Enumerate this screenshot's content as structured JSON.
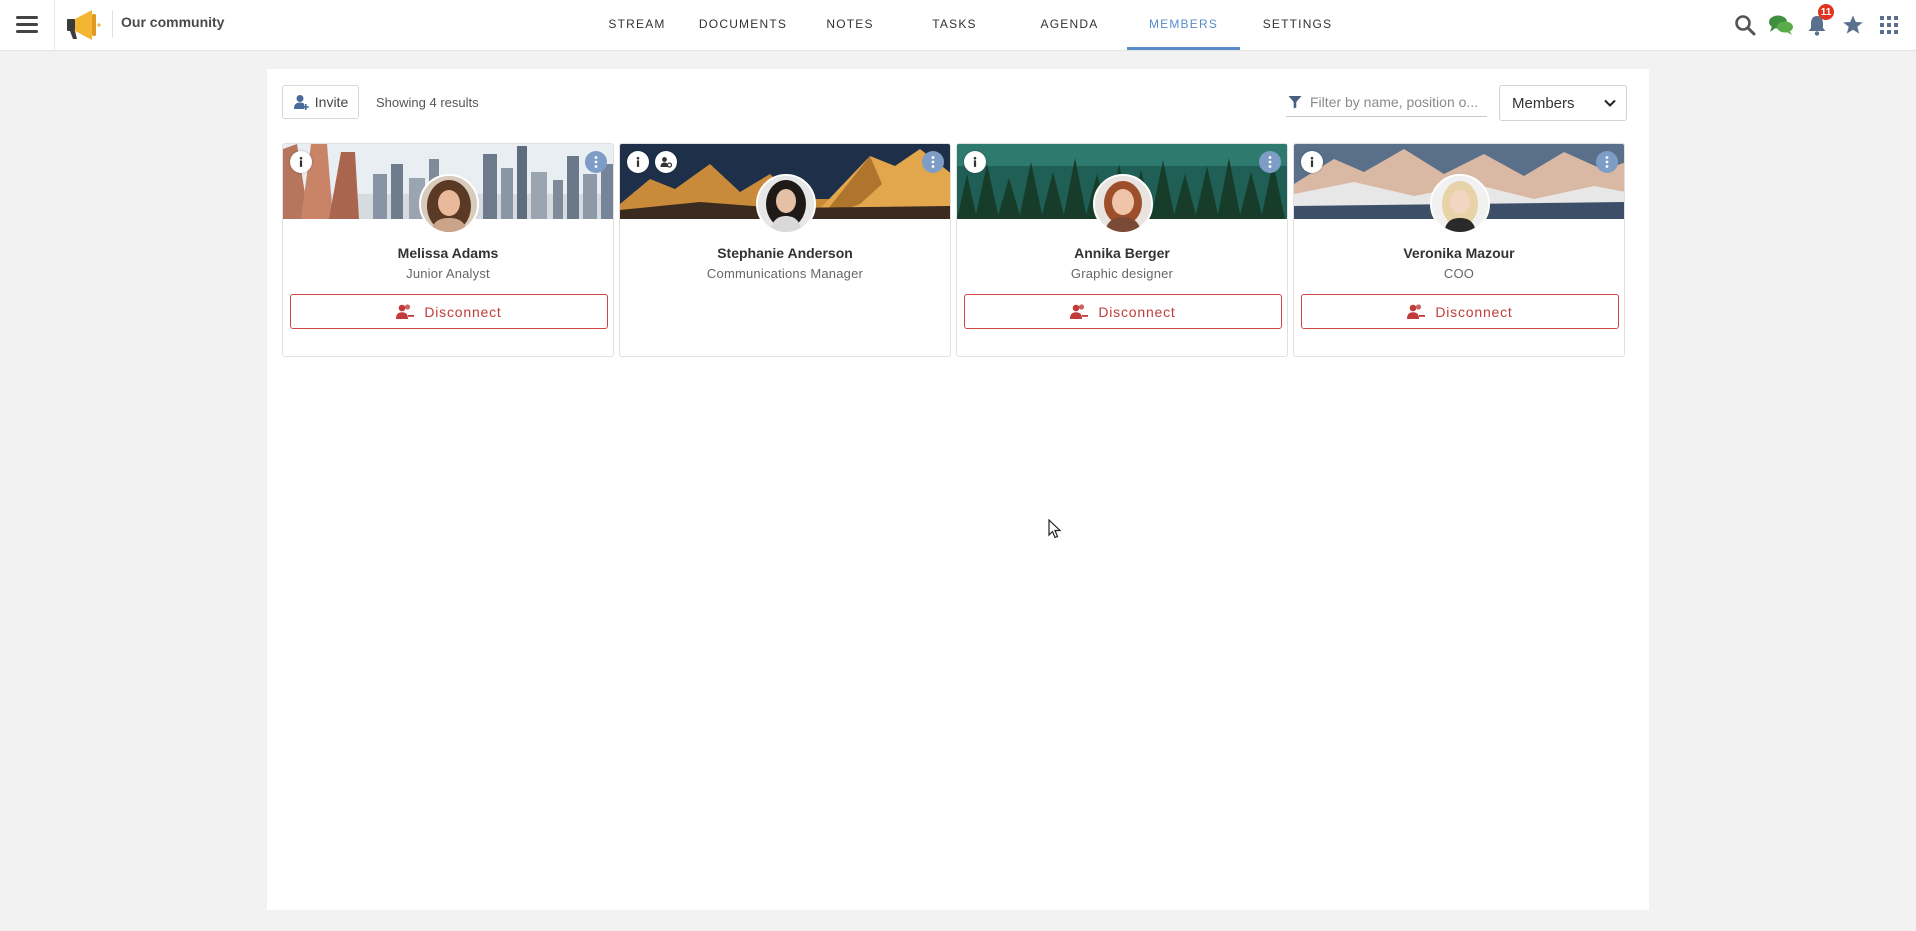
{
  "header": {
    "space_name": "Our community",
    "tabs": [
      {
        "label": "STREAM",
        "active": false
      },
      {
        "label": "DOCUMENTS",
        "active": false
      },
      {
        "label": "NOTES",
        "active": false
      },
      {
        "label": "TASKS",
        "active": false
      },
      {
        "label": "AGENDA",
        "active": false
      },
      {
        "label": "MEMBERS",
        "active": true
      },
      {
        "label": "SETTINGS",
        "active": false
      }
    ],
    "notifications_count": "11",
    "icons": [
      "search-icon",
      "chat-icon",
      "bell-icon",
      "star-icon",
      "apps-grid-icon"
    ]
  },
  "toolbar": {
    "invite_label": "Invite",
    "results_text": "Showing 4 results",
    "filter_placeholder": "Filter by name, position o...",
    "role_select": "Members"
  },
  "members": [
    {
      "name": "Melissa Adams",
      "position": "Junior Analyst",
      "action": "Disconnect",
      "banner": "city"
    },
    {
      "name": "Stephanie Anderson",
      "position": "Communications Manager",
      "action": "",
      "banner": "mountains-sunset"
    },
    {
      "name": "Annika Berger",
      "position": "Graphic designer",
      "action": "Disconnect",
      "banner": "forest"
    },
    {
      "name": "Veronika Mazour",
      "position": "COO",
      "action": "Disconnect",
      "banner": "snowy-mountains"
    }
  ],
  "colors": {
    "accent": "#578dc9",
    "danger": "#c23b3b",
    "badge": "#e0341f",
    "background": "#f2f2f2"
  }
}
